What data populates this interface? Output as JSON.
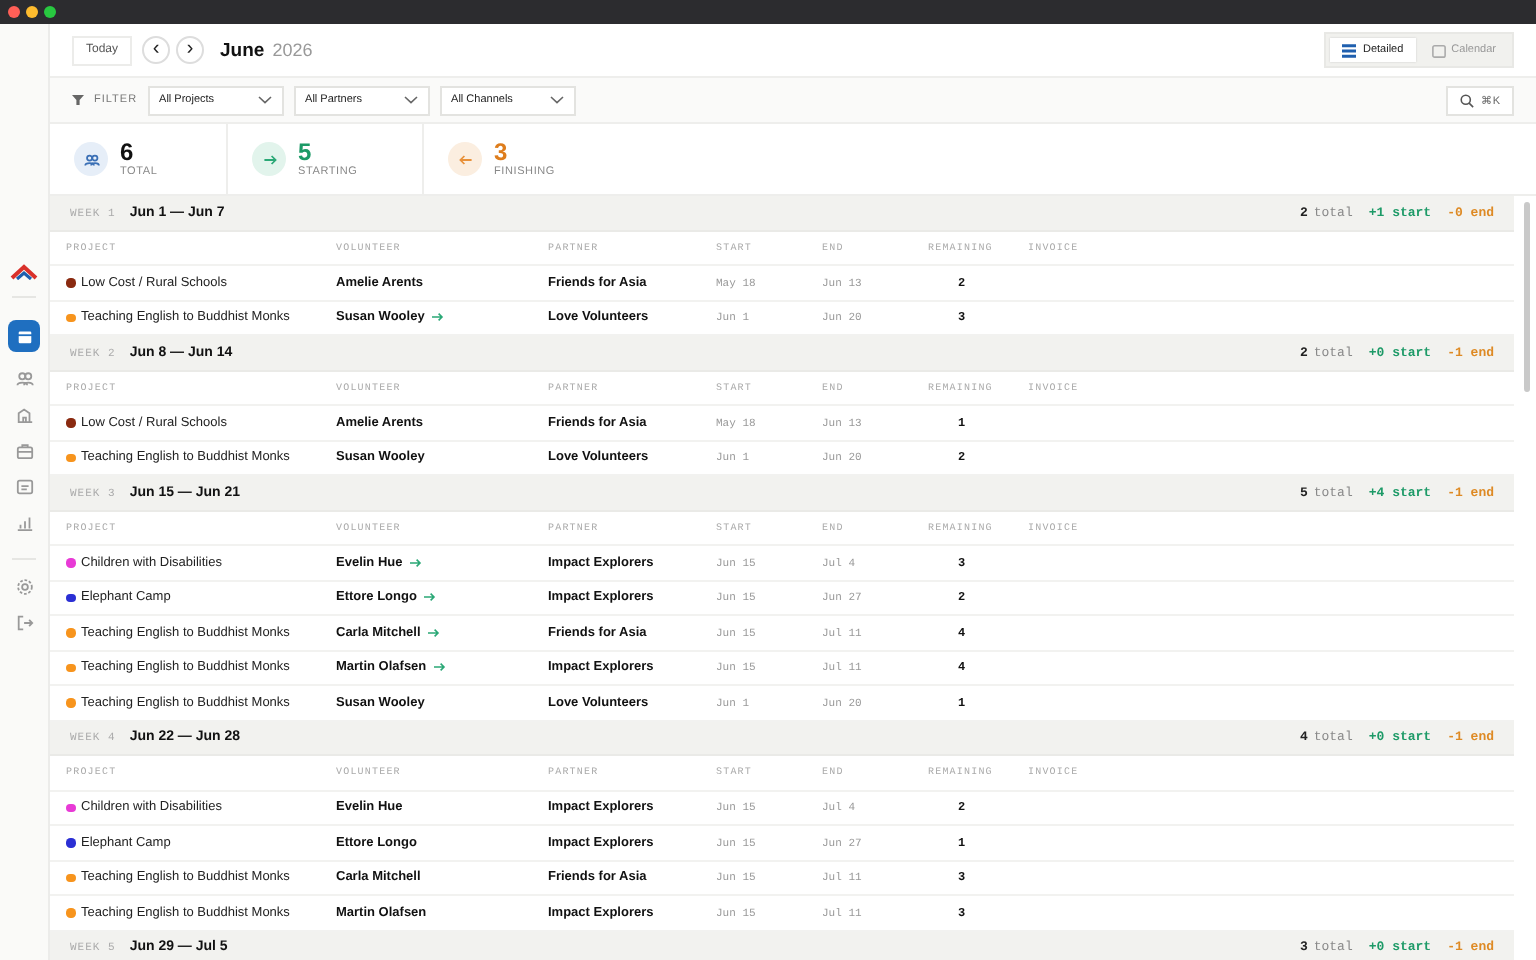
{
  "toolbar": {
    "today": "Today",
    "prev": "‹",
    "next": "›",
    "month": "June",
    "year": "2026",
    "views": [
      {
        "label": "Detailed",
        "kind": "list",
        "selected": true
      },
      {
        "label": "Calendar",
        "kind": "calendar",
        "selected": false
      }
    ]
  },
  "sidebar": {
    "nav": [
      {
        "kind": "calendar",
        "selected": true
      },
      {
        "kind": "people",
        "selected": false
      },
      {
        "kind": "building",
        "selected": false
      },
      {
        "kind": "briefcase",
        "selected": false
      },
      {
        "kind": "message",
        "selected": false
      },
      {
        "kind": "chart",
        "selected": false
      }
    ],
    "bottom": [
      {
        "kind": "settings"
      },
      {
        "kind": "logout"
      }
    ]
  },
  "filter": {
    "label": "FILTER",
    "dropdowns": [
      "All Projects",
      "All Partners",
      "All Channels"
    ],
    "search": "⌘K"
  },
  "stats": [
    {
      "kind": "total",
      "value": "6",
      "label": "TOTAL"
    },
    {
      "kind": "starting",
      "value": "5",
      "label": "STARTING"
    },
    {
      "kind": "finishing",
      "value": "3",
      "label": "FINISHING"
    }
  ],
  "weeks": [
    {
      "label": "WEEK 1",
      "range": "Jun 1 — Jun 7",
      "total": "2",
      "total_label": "total",
      "start": "+1 start",
      "end": "-0 end",
      "columns": [
        "PROJECT",
        "VOLUNTEER",
        "PARTNER",
        "START",
        "END",
        "REMAINING",
        "INVOICE"
      ],
      "rows": [
        {
          "project": "Low Cost / Rural Schools",
          "color": "#8a2a10",
          "volunteer": "Amelie Arents",
          "starting": false,
          "partner": "Friends for Asia",
          "start": "May 18",
          "end": "Jun 13",
          "remaining": "2"
        },
        {
          "project": "Teaching English to Buddhist Monks",
          "color": "#f7941d",
          "volunteer": "Susan Wooley",
          "starting": true,
          "partner": "Love Volunteers",
          "start": "Jun 1",
          "end": "Jun 20",
          "remaining": "3"
        }
      ]
    },
    {
      "label": "WEEK 2",
      "range": "Jun 8 — Jun 14",
      "total": "2",
      "total_label": "total",
      "start": "+0 start",
      "end": "-1 end",
      "columns": [
        "PROJECT",
        "VOLUNTEER",
        "PARTNER",
        "START",
        "END",
        "REMAINING",
        "INVOICE"
      ],
      "rows": [
        {
          "project": "Low Cost / Rural Schools",
          "color": "#8a2a10",
          "volunteer": "Amelie Arents",
          "starting": false,
          "partner": "Friends for Asia",
          "start": "May 18",
          "end": "Jun 13",
          "remaining": "1"
        },
        {
          "project": "Teaching English to Buddhist Monks",
          "color": "#f7941d",
          "volunteer": "Susan Wooley",
          "starting": false,
          "partner": "Love Volunteers",
          "start": "Jun 1",
          "end": "Jun 20",
          "remaining": "2"
        }
      ]
    },
    {
      "label": "WEEK 3",
      "range": "Jun 15 — Jun 21",
      "total": "5",
      "total_label": "total",
      "start": "+4 start",
      "end": "-1 end",
      "columns": [
        "PROJECT",
        "VOLUNTEER",
        "PARTNER",
        "START",
        "END",
        "REMAINING",
        "INVOICE"
      ],
      "rows": [
        {
          "project": "Children with Disabilities",
          "color": "#e83ad6",
          "volunteer": "Evelin Hue",
          "starting": true,
          "partner": "Impact Explorers",
          "start": "Jun 15",
          "end": "Jul 4",
          "remaining": "3"
        },
        {
          "project": "Elephant Camp",
          "color": "#2b2fd4",
          "volunteer": "Ettore Longo",
          "starting": true,
          "partner": "Impact Explorers",
          "start": "Jun 15",
          "end": "Jun 27",
          "remaining": "2"
        },
        {
          "project": "Teaching English to Buddhist Monks",
          "color": "#f7941d",
          "volunteer": "Carla Mitchell",
          "starting": true,
          "partner": "Friends for Asia",
          "start": "Jun 15",
          "end": "Jul 11",
          "remaining": "4"
        },
        {
          "project": "Teaching English to Buddhist Monks",
          "color": "#f7941d",
          "volunteer": "Martin Olafsen",
          "starting": true,
          "partner": "Impact Explorers",
          "start": "Jun 15",
          "end": "Jul 11",
          "remaining": "4"
        },
        {
          "project": "Teaching English to Buddhist Monks",
          "color": "#f7941d",
          "volunteer": "Susan Wooley",
          "starting": false,
          "partner": "Love Volunteers",
          "start": "Jun 1",
          "end": "Jun 20",
          "remaining": "1"
        }
      ]
    },
    {
      "label": "WEEK 4",
      "range": "Jun 22 — Jun 28",
      "total": "4",
      "total_label": "total",
      "start": "+0 start",
      "end": "-1 end",
      "columns": [
        "PROJECT",
        "VOLUNTEER",
        "PARTNER",
        "START",
        "END",
        "REMAINING",
        "INVOICE"
      ],
      "rows": [
        {
          "project": "Children with Disabilities",
          "color": "#e83ad6",
          "volunteer": "Evelin Hue",
          "starting": false,
          "partner": "Impact Explorers",
          "start": "Jun 15",
          "end": "Jul 4",
          "remaining": "2"
        },
        {
          "project": "Elephant Camp",
          "color": "#2b2fd4",
          "volunteer": "Ettore Longo",
          "starting": false,
          "partner": "Impact Explorers",
          "start": "Jun 15",
          "end": "Jun 27",
          "remaining": "1"
        },
        {
          "project": "Teaching English to Buddhist Monks",
          "color": "#f7941d",
          "volunteer": "Carla Mitchell",
          "starting": false,
          "partner": "Friends for Asia",
          "start": "Jun 15",
          "end": "Jul 11",
          "remaining": "3"
        },
        {
          "project": "Teaching English to Buddhist Monks",
          "color": "#f7941d",
          "volunteer": "Martin Olafsen",
          "starting": false,
          "partner": "Impact Explorers",
          "start": "Jun 15",
          "end": "Jul 11",
          "remaining": "3"
        }
      ]
    },
    {
      "label": "WEEK 5",
      "range": "Jun 29 — Jul 5",
      "total": "3",
      "total_label": "total",
      "start": "+0 start",
      "end": "-1 end"
    }
  ]
}
